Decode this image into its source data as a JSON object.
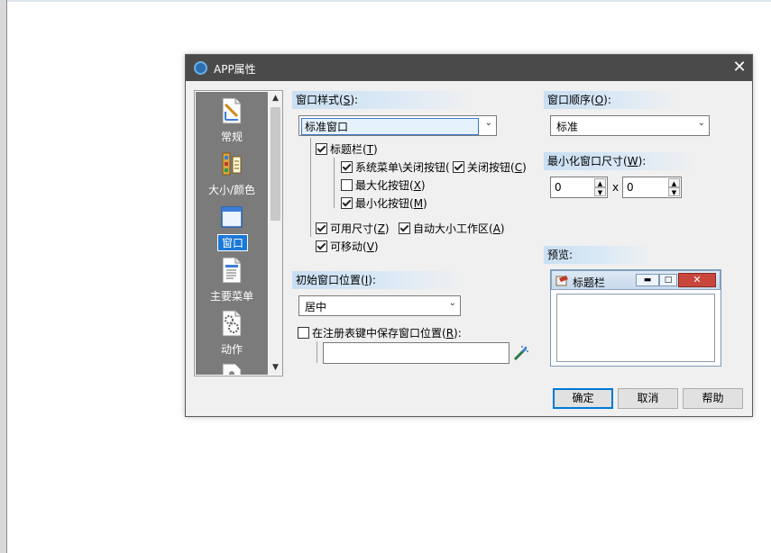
{
  "dialog": {
    "title": "APP属性",
    "close_label": "✕"
  },
  "categories": [
    {
      "label": "常规",
      "icon": "ruler-pencil-icon"
    },
    {
      "label": "大小/颜色",
      "icon": "paint-palette-icon"
    },
    {
      "label": "窗口",
      "icon": "window-icon",
      "selected": true
    },
    {
      "label": "主要菜单",
      "icon": "document-menu-icon"
    },
    {
      "label": "动作",
      "icon": "gear-document-icon"
    }
  ],
  "window_style": {
    "header_pre": "窗口样式(",
    "header_key": "S",
    "header_post": "):",
    "value": "标准窗口",
    "titlebar": {
      "pre": "标题栏(",
      "key": "T",
      "post": ")",
      "checked": true
    },
    "sysmenu_close": {
      "label": "系统菜单\\关闭按钮(",
      "checked": true
    },
    "close_button": {
      "pre": "关闭按钮(",
      "key": "C",
      "post": ")",
      "checked": true
    },
    "maximize": {
      "pre": "最大化按钮(",
      "key": "X",
      "post": ")",
      "checked": false
    },
    "minimize": {
      "pre": "最小化按钮(",
      "key": "M",
      "post": ")",
      "checked": true
    },
    "usable_size": {
      "pre": "可用尺寸(",
      "key": "Z",
      "post": ")",
      "checked": true
    },
    "auto_size": {
      "pre": "自动大小工作区(",
      "key": "A",
      "post": ")",
      "checked": true
    },
    "movable": {
      "pre": "可移动(",
      "key": "V",
      "post": ")",
      "checked": true
    }
  },
  "window_order": {
    "header_pre": "窗口顺序(",
    "header_key": "O",
    "header_post": "):",
    "value": "标准"
  },
  "min_size": {
    "header_pre": "最小化窗口尺寸(",
    "header_key": "W",
    "header_post": "):",
    "width": "0",
    "height": "0",
    "separator": "x"
  },
  "initial_position": {
    "header_pre": "初始窗口位置(",
    "header_key": "I",
    "header_post": "):",
    "value": "居中",
    "save_in_registry": {
      "pre": "在注册表键中保存窗口位置(",
      "key": "R",
      "post": "):",
      "checked": false
    },
    "registry_key_value": ""
  },
  "preview": {
    "header": "预览:",
    "window_title": "标题栏"
  },
  "buttons": {
    "ok": "确定",
    "cancel": "取消",
    "help": "帮助"
  },
  "colors": {
    "titlebar": "#4a4a4a",
    "selection": "#1a78d7",
    "category_bg": "#7b7b7b",
    "close_button_red": "#c9463d"
  }
}
